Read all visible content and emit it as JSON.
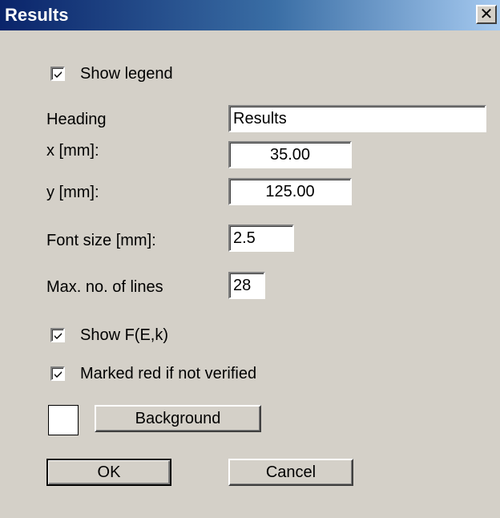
{
  "window": {
    "title": "Results",
    "close_glyph": "✕"
  },
  "options": {
    "show_legend": {
      "label": "Show legend",
      "checked": true
    },
    "show_fek": {
      "label": "Show F(E,k)",
      "checked": true
    },
    "marked_red": {
      "label": "Marked red if not verified",
      "checked": true
    }
  },
  "fields": {
    "heading": {
      "label": "Heading",
      "value": "Results"
    },
    "x": {
      "label": "x [mm]:",
      "value": "35.00"
    },
    "y": {
      "label": "y [mm]:",
      "value": "125.00"
    },
    "font_size": {
      "label": "Font size [mm]:",
      "value": "2.5"
    },
    "max_lines": {
      "label": "Max. no. of lines",
      "value": "28"
    }
  },
  "background": {
    "label": "Background",
    "swatch_color": "#ffffff"
  },
  "buttons": {
    "ok": "OK",
    "cancel": "Cancel"
  },
  "colors": {
    "titlebar_start": "#0a246a",
    "titlebar_end": "#a6caf0",
    "dialog_bg": "#d4d0c8"
  }
}
